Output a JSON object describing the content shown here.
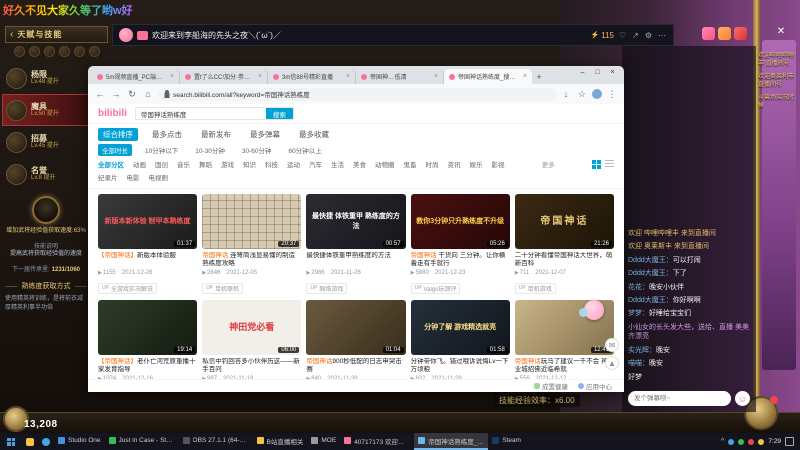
{
  "overlay": {
    "rainbow_text": "好久不见大家久等了哟w好"
  },
  "stream_header": {
    "title": "欢迎来到李船海的先头之夜＼(´ω`)／",
    "viewers": "115",
    "icons": {
      "bolt": "⚡",
      "like": "♡",
      "share": "↗",
      "settings": "⚙",
      "more": "⋯"
    }
  },
  "window": {
    "close": "✕"
  },
  "game": {
    "titlebar": {
      "back": "‹",
      "title": "天赋与技能"
    },
    "menu": [
      {
        "name": "杨限",
        "lv": "Lv.48 提升",
        "cls": ""
      },
      {
        "name": "魔具",
        "lv": "Lv.50 提升",
        "cls": "active"
      },
      {
        "name": "招募",
        "lv": "Lv.45 提升",
        "cls": ""
      },
      {
        "name": "名誉",
        "lv": "Lv.8 提升",
        "cls": ""
      }
    ],
    "skill": {
      "effect": "增加武将经验值获取速度:63%",
      "desc_label": "技能说明",
      "desc": "提高武将获取经验值的速度",
      "next_label": "下一届传承里:",
      "next_value": "1231/1060",
      "method_title": "熟练度获取方式",
      "method_text": "使用精英将训练，是将前衣减厚精英利事半功倍"
    },
    "xp": "13,208",
    "efficiency": "技能经验效率：x6.00",
    "system_messages": [
      "欢迎哔哩哔哩丰 直播间号",
      "欢迎奥莱利丰 直播间号",
      "斗兽场实况时候"
    ]
  },
  "browser": {
    "tabs": [
      {
        "title": "5m视频直播_PC端游社区",
        "cls": ""
      },
      {
        "title": "置t了么CC!加分·参与侦信",
        "cls": ""
      },
      {
        "title": "3m信88号精彩直播",
        "cls": ""
      },
      {
        "title": "帝国神... 低清",
        "cls": ""
      },
      {
        "title": "帝国神话熟练度_搜索结果_哔哩哔...",
        "cls": "active"
      }
    ],
    "chrome": {
      "newtab": "+",
      "min": "–",
      "max": "□",
      "close": "×",
      "back": "←",
      "forward": "→",
      "refresh": "↻",
      "home": "⌂",
      "download": "↓",
      "star": "☆",
      "menu": "⋮"
    },
    "url": "search.bilibili.com/all?keyword=帝国神话熟练度"
  },
  "bili": {
    "logo": "bilibili",
    "search_value": "帝国神话熟练度",
    "search_button": "搜索",
    "sort_tabs": [
      {
        "label": "综合排序",
        "cls": "active"
      },
      {
        "label": "最多点击",
        "cls": ""
      },
      {
        "label": "最新发布",
        "cls": ""
      },
      {
        "label": "最多弹幕",
        "cls": ""
      },
      {
        "label": "最多收藏",
        "cls": ""
      }
    ],
    "durations": [
      {
        "label": "全部时长",
        "cls": "active"
      },
      {
        "label": "10分钟以下",
        "cls": ""
      },
      {
        "label": "10-30分钟",
        "cls": ""
      },
      {
        "label": "30-60分钟",
        "cls": ""
      },
      {
        "label": "60分钟以上",
        "cls": ""
      }
    ],
    "categories": [
      {
        "label": "全部分区",
        "cls": "active"
      },
      {
        "label": "动画",
        "cls": ""
      },
      {
        "label": "国创",
        "cls": ""
      },
      {
        "label": "音乐",
        "cls": ""
      },
      {
        "label": "舞蹈",
        "cls": ""
      },
      {
        "label": "游戏",
        "cls": ""
      },
      {
        "label": "知识",
        "cls": ""
      },
      {
        "label": "科技",
        "cls": ""
      },
      {
        "label": "运动",
        "cls": ""
      },
      {
        "label": "汽车",
        "cls": ""
      },
      {
        "label": "生活",
        "cls": ""
      },
      {
        "label": "美食",
        "cls": ""
      },
      {
        "label": "动物圈",
        "cls": ""
      },
      {
        "label": "鬼畜",
        "cls": ""
      },
      {
        "label": "时尚",
        "cls": ""
      },
      {
        "label": "资讯",
        "cls": ""
      },
      {
        "label": "娱乐",
        "cls": ""
      },
      {
        "label": "影视",
        "cls": ""
      }
    ],
    "categories2": [
      {
        "label": "纪录片",
        "cls": ""
      },
      {
        "label": "电影",
        "cls": ""
      },
      {
        "label": "电视剧",
        "cls": ""
      }
    ],
    "more_link": "更多",
    "videos": [
      {
        "thumb": "t1",
        "thumb_text": "新版本新体验 制甲本熟练度",
        "duration": "01:37",
        "hl": "【帝国神话】",
        "title": "新版本体验服",
        "views": "1155",
        "date": "2021-12-26",
        "tag": "全游戏实况解说"
      },
      {
        "thumb": "t2",
        "thumb_text": "",
        "duration": "20:37",
        "hl": "帝国神话",
        "title": " 连弩简浅显易懂的制造熟练度攻略",
        "views": "2846",
        "date": "2021-12-05",
        "tag": "单机联机"
      },
      {
        "thumb": "t3",
        "thumb_text": "最快捷 体铁重甲 熟练度的方法",
        "duration": "00:57",
        "hl": "",
        "title": "最快捷体铁重甲熟练度的方法",
        "views": "2986",
        "date": "2021-11-26",
        "tag": "网络游戏"
      },
      {
        "thumb": "t4",
        "thumb_text": "教你3分钟只升熟练度不升级",
        "duration": "05:26",
        "hl": "帝国神话",
        "title": " 干货向 三分钟。让你横着走有手就行",
        "views": "5880",
        "date": "2021-12-23",
        "tag": "Valgo玩测评"
      },
      {
        "thumb": "t5",
        "thumb_text": "帝国神话",
        "duration": "21:26",
        "hl": "",
        "title": "二十分钟看懂帝国神话大世界，萌新百科",
        "views": "711",
        "date": "2021-12-07",
        "tag": "单机游戏"
      },
      {
        "thumb": "t6",
        "thumb_text": "",
        "duration": "19:14",
        "hl": "【帝国神话】",
        "title": "老仆亡河荒原重播十家发育指导",
        "views": "1024",
        "date": "2021-12-16",
        "tag": "全游戏实况解说"
      },
      {
        "thumb": "t7",
        "thumb_text": "神田党必看",
        "duration": "06:00",
        "hl": "",
        "title": "私信中钓回答多小伙伴历这——新手百问",
        "views": "987",
        "date": "2021-11-18",
        "tag": "网络游戏"
      },
      {
        "thumb": "t8",
        "thumb_text": "",
        "duration": "01:04",
        "hl": "帝国神话",
        "title": "900秒低配的日志申突击赛",
        "views": "640",
        "date": "2021-11-28",
        "tag": "单机游戏"
      },
      {
        "thumb": "t9",
        "thumb_text": "分钟了解 游戏精选就亮",
        "duration": "01:58",
        "hl": "",
        "title": "分钟带你飞。错过哦诉说悔Lv一下万顷粮",
        "views": "832",
        "date": "2021-11-28",
        "tag": "网络游戏"
      },
      {
        "thumb": "t10",
        "thumb_text": "",
        "duration": "12:41",
        "hl": "帝国神话",
        "title": "玩马了建议一千不会 神业城招佛近临希就",
        "views": "556",
        "date": "2021-12-12",
        "tag": "单机联机"
      }
    ],
    "footer_links": [
      "成置健康",
      "应用中心"
    ]
  },
  "chat": {
    "messages": [
      {
        "user": "",
        "text": "欢迎 哔哩哔哩丰 来到直播间",
        "type": "system"
      },
      {
        "user": "",
        "text": "欢迎 奥莱斯丰 来到直播间",
        "type": "system"
      },
      {
        "user": "Dddd大魔王",
        "text": "可以打闹",
        "type": "normal"
      },
      {
        "user": "Dddd大魔王",
        "text": "下了",
        "type": "normal"
      },
      {
        "user": "花花",
        "text": "晚安小伙伴",
        "type": "normal"
      },
      {
        "user": "Dddd大魔王",
        "text": "你好啊啊",
        "type": "normal"
      },
      {
        "user": "梦梦",
        "text": "好睡给宝宝们",
        "type": "normal"
      },
      {
        "user": "",
        "text": "小仙女的长头发大些，送给、直播 美美齐漂亮",
        "type": "gift"
      },
      {
        "user": "实光辉",
        "text": "晚安",
        "type": "normal"
      },
      {
        "user": "喵喵",
        "text": "晚安",
        "type": "normal"
      },
      {
        "user": "",
        "text": "好梦",
        "type": "normal"
      }
    ],
    "input_placeholder": "发个弹幕呗~",
    "emoji_glyph": "☺"
  },
  "taskbar": {
    "items": [
      {
        "label": "Studio One",
        "ico": "ic-blue",
        "cls": ""
      },
      {
        "label": "Just in Case - Stevie...",
        "ico": "ic-green",
        "cls": ""
      },
      {
        "label": "OBS 27.1.1 (64-bit...",
        "ico": "ic-dark",
        "cls": ""
      },
      {
        "label": "B站直播相关",
        "ico": "ic-yellow",
        "cls": ""
      },
      {
        "label": "MOE",
        "ico": "ic-gray",
        "cls": ""
      },
      {
        "label": "40717173 欢迎来到...",
        "ico": "ic-pink",
        "cls": ""
      },
      {
        "label": "帝国神话熟练度_搜索结果...",
        "ico": "ic-blue2",
        "cls": "active"
      },
      {
        "label": "Steam",
        "ico": "ic-steam",
        "cls": ""
      }
    ],
    "tray_expand": "^",
    "time": "7:29"
  }
}
